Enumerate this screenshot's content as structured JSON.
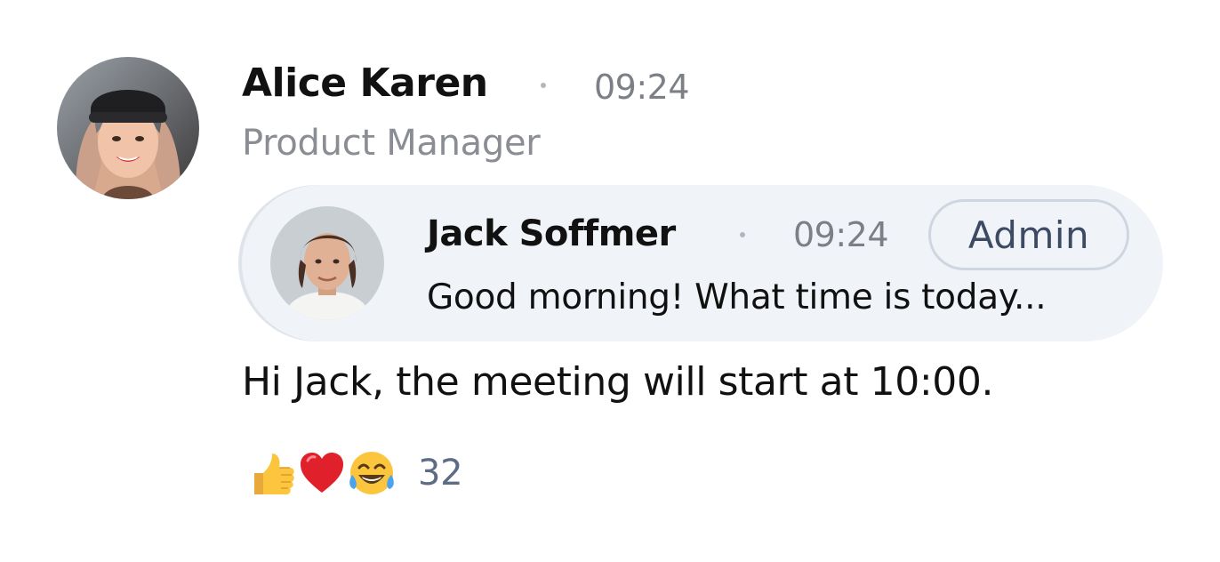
{
  "message": {
    "author": {
      "name": "Alice Karen",
      "role": "Product Manager",
      "avatar": "woman-avatar"
    },
    "time": "09:24",
    "reply_to": {
      "author": {
        "name": "Jack Soffmer",
        "avatar": "man-avatar"
      },
      "time": "09:24",
      "badge": "Admin",
      "text": "Good morning! What time is today..."
    },
    "text": "Hi Jack, the meeting will start at 10:00.",
    "reactions": {
      "emojis": [
        "thumbs-up-icon",
        "red-heart-icon",
        "tears-of-joy-icon"
      ],
      "count": "32"
    }
  }
}
